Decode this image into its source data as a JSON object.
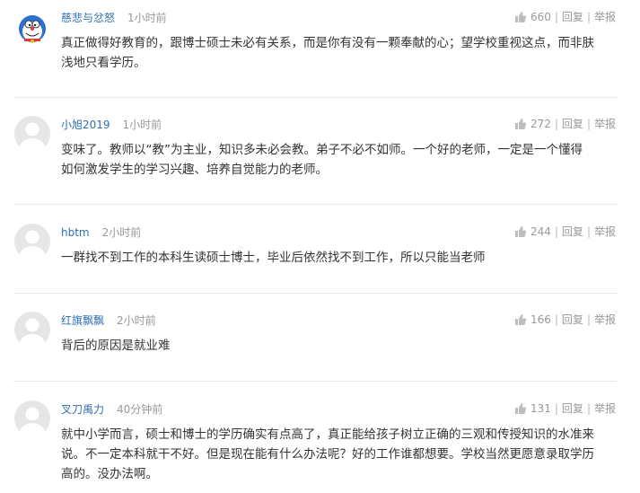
{
  "comments": [
    {
      "username": "慈悲与忿怒",
      "time": "1小时前",
      "likes": "660",
      "reply": "回复",
      "report": "举报",
      "lines": [
        "真正做得好教育的，跟博士硕士未必有关系，而是你有没有一颗奉献的心；望学校重视这点，而非肤",
        "浅地只看学历。"
      ],
      "avatar_icon": "cartoon-character-avatar"
    },
    {
      "username": "小旭2019",
      "time": "1小时前",
      "likes": "272",
      "reply": "回复",
      "report": "举报",
      "lines": [
        "变味了。教师以“教”为主业，知识多未必会教。弟子不必不如师。一个好的老师，一定是一个懂得",
        "如何激发学生的学习兴趣、培养自觉能力的老师。"
      ],
      "avatar_icon": "default-user-avatar"
    },
    {
      "username": "hbtm",
      "time": "2小时前",
      "likes": "244",
      "reply": "回复",
      "report": "举报",
      "lines": [
        "一群找不到工作的本科生读硕士博士，毕业后依然找不到工作，所以只能当老师"
      ],
      "avatar_icon": "default-user-avatar"
    },
    {
      "username": "红旗飘飘",
      "time": "2小时前",
      "likes": "166",
      "reply": "回复",
      "report": "举报",
      "lines": [
        "背后的原因是就业难"
      ],
      "avatar_icon": "default-user-avatar"
    },
    {
      "username": "叉刀禹力",
      "time": "40分钟前",
      "likes": "131",
      "reply": "回复",
      "report": "举报",
      "lines": [
        "就中小学而言，硕士和博士的学历确实有点高了，真正能给孩子树立正确的三观和传授知识的水准来",
        "说。不一定本科就干不好。但是现在能有什么办法呢？好的工作谁都想要。学校当然更愿意录取学历",
        "高的。没办法啊。"
      ],
      "avatar_icon": "default-user-avatar"
    }
  ],
  "colors": {
    "username": "#2d6fb5",
    "meta": "#999999",
    "text": "#333333",
    "divider": "#e8e8e8"
  }
}
